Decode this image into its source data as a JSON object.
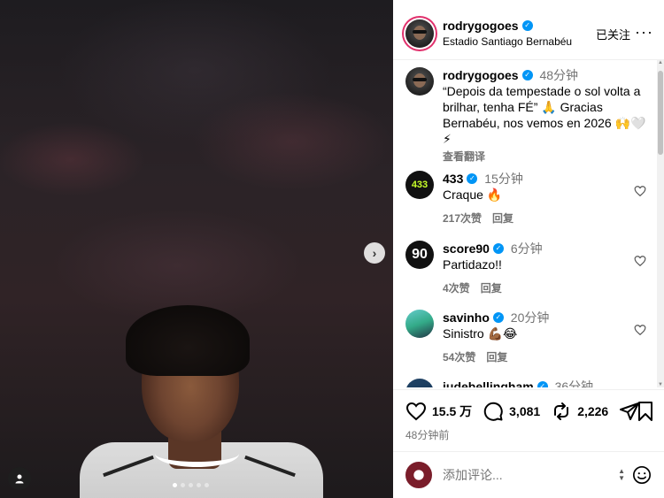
{
  "post": {
    "username": "rodrygogoes",
    "location": "Estadio Santiago Bernabéu",
    "follow_label": "已关注",
    "more_label": "···",
    "carousel_next": "›"
  },
  "caption": {
    "username": "rodrygogoes",
    "time": "48分钟",
    "text": "“Depois da tempestade o sol volta a brilhar, tenha FÉ” 🙏 Gracias Bernabéu, nos vemos en 2026 🙌🤍⚡",
    "translate_label": "查看翻译"
  },
  "comments": [
    {
      "username": "433",
      "avatar_text": "433",
      "time": "15分钟",
      "text": "Craque 🔥",
      "likes": "217次赞",
      "reply": "回复"
    },
    {
      "username": "score90",
      "avatar_text": "90",
      "time": "6分钟",
      "text": "Partidazo!!",
      "likes": "4次赞",
      "reply": "回复"
    },
    {
      "username": "savinho",
      "avatar_text": "",
      "time": "20分钟",
      "text": "Sinistro 💪🏾😂",
      "likes": "54次赞",
      "reply": "回复"
    },
    {
      "username": "judebellingham",
      "avatar_text": "",
      "time": "36分钟",
      "text": "",
      "likes": "",
      "reply": ""
    }
  ],
  "actions": {
    "likes": "15.5 万",
    "comments": "3,081",
    "reposts": "2,226"
  },
  "posted_ago": "48分钟前",
  "add_comment": {
    "placeholder": "添加评论..."
  },
  "colors": {
    "verified": "#0095f6",
    "muted": "#737373",
    "border": "#efefef"
  }
}
